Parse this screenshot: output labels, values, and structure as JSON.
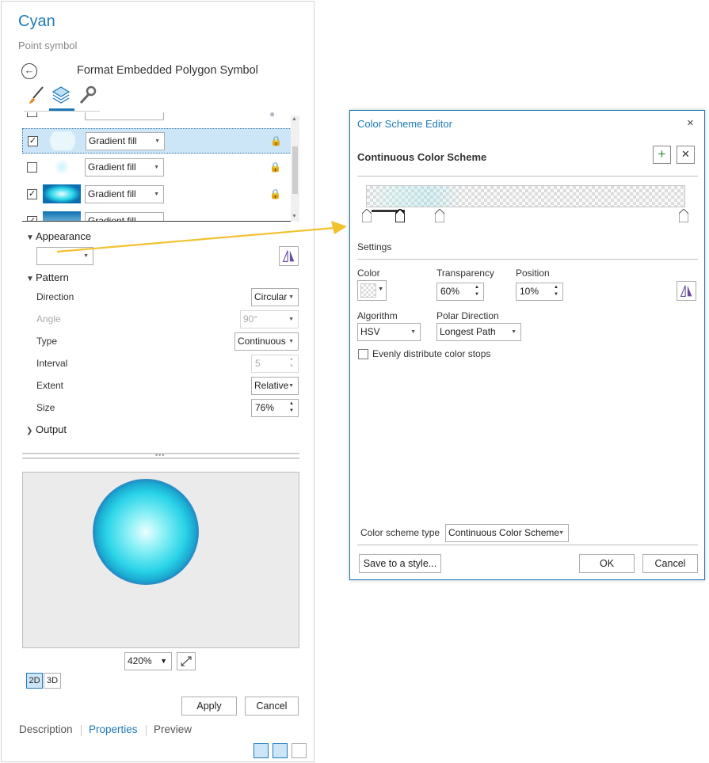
{
  "left_panel": {
    "title": "Cyan",
    "subtitle": "Point symbol",
    "format_title": "Format Embedded Polygon Symbol",
    "tabs": [
      {
        "icon": "paintbrush-icon"
      },
      {
        "icon": "layers-icon",
        "active": true
      },
      {
        "icon": "wrench-icon"
      }
    ],
    "layers": [
      {
        "checked": false,
        "label": "",
        "partial": true
      },
      {
        "checked": true,
        "label": "Gradient fill",
        "selected": true
      },
      {
        "checked": false,
        "label": "Gradient fill"
      },
      {
        "checked": true,
        "label": "Gradient fill"
      },
      {
        "checked": true,
        "label": "Gradient fill",
        "partial": true
      }
    ],
    "appearance": {
      "header": "Appearance",
      "color_value": ""
    },
    "pattern": {
      "header": "Pattern",
      "direction_label": "Direction",
      "direction_value": "Circular",
      "angle_label": "Angle",
      "angle_value": "90°",
      "type_label": "Type",
      "type_value": "Continuous",
      "interval_label": "Interval",
      "interval_value": "5",
      "extent_label": "Extent",
      "extent_value": "Relative",
      "size_label": "Size",
      "size_value": "76%"
    },
    "output": {
      "header": "Output"
    },
    "zoom": "420%",
    "view_2d": "2D",
    "view_3d": "3D",
    "apply": "Apply",
    "cancel": "Cancel",
    "bottom_tabs": {
      "description": "Description",
      "properties": "Properties",
      "preview": "Preview"
    }
  },
  "dialog": {
    "title": "Color Scheme Editor",
    "close_icon": "×",
    "scheme_heading": "Continuous Color Scheme",
    "add_icon": "+",
    "remove_icon": "✕",
    "settings": "Settings",
    "color_label": "Color",
    "transparency_label": "Transparency",
    "transparency_value": "60%",
    "position_label": "Position",
    "position_value": "10%",
    "algorithm_label": "Algorithm",
    "algorithm_value": "HSV",
    "polar_label": "Polar Direction",
    "polar_value": "Longest Path",
    "evenly_label": "Evenly distribute color stops",
    "evenly_checked": false,
    "scheme_type_label": "Color scheme type",
    "scheme_type_value": "Continuous Color Scheme",
    "save_button": "Save to a style...",
    "ok_button": "OK",
    "cancel_button": "Cancel"
  },
  "colors": {
    "accent": "#1e7ab8",
    "arrow": "#f2c12e",
    "cyan": "#2ad4e8"
  }
}
